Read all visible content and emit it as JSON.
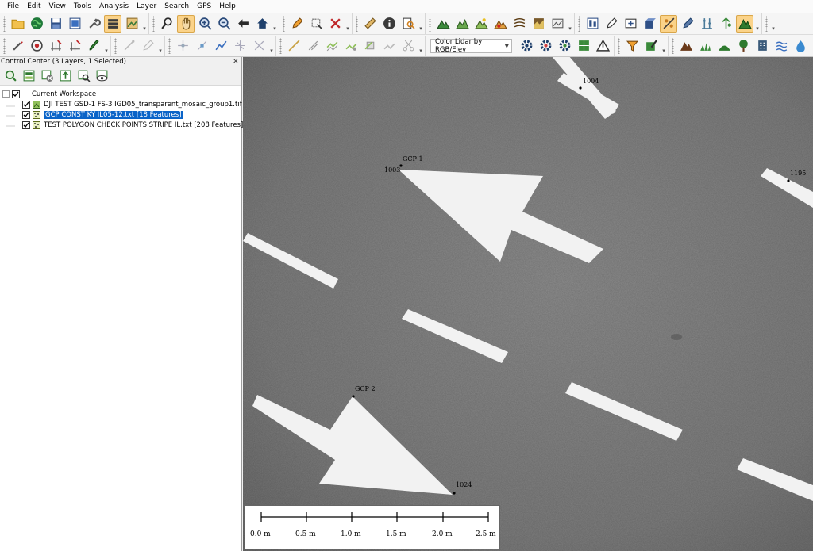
{
  "menu": [
    "File",
    "Edit",
    "View",
    "Tools",
    "Analysis",
    "Layer",
    "Search",
    "GPS",
    "Help"
  ],
  "toolbar": {
    "shader_dropdown": "Color Lidar by RGB/Elev"
  },
  "control_center": {
    "title": "Control Center (3 Layers, 1 Selected)",
    "close": "×",
    "workspace": "Current Workspace",
    "layers": [
      {
        "label": "DJI TEST GSD-1 FS-3 IGD05_transparent_mosaic_group1.tif",
        "selected": false
      },
      {
        "label": "GCP CONST KY IL05-12.txt [18 Features]",
        "selected": true
      },
      {
        "label": "TEST POLYGON CHECK POINTS STRIPE IL.txt [208 Features]",
        "selected": false
      }
    ]
  },
  "map": {
    "points": [
      {
        "label": "1004"
      },
      {
        "label": "GCP 1"
      },
      {
        "label": "1003"
      },
      {
        "label": "1195"
      },
      {
        "label": "GCP 2"
      },
      {
        "label": "1024"
      }
    ],
    "scale_bar": [
      "0.0 m",
      "0.5 m",
      "1.0 m",
      "1.5 m",
      "2.0 m",
      "2.5 m"
    ]
  }
}
